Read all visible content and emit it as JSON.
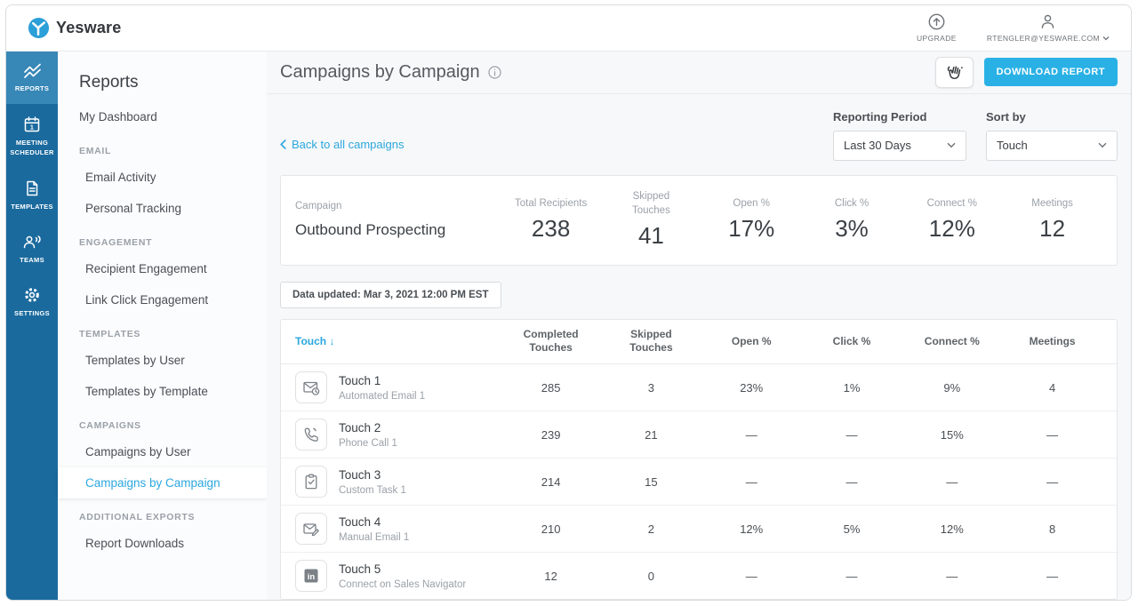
{
  "header": {
    "brand": "Yesware",
    "upgrade_label": "UPGRADE",
    "account_email": "RTENGLER@YESWARE.COM"
  },
  "nav_rail": {
    "items": [
      {
        "label": "REPORTS",
        "icon": "chart-icon",
        "active": true
      },
      {
        "label": "MEETING SCHEDULER",
        "icon": "calendar-icon",
        "active": false
      },
      {
        "label": "TEMPLATES",
        "icon": "document-icon",
        "active": false
      },
      {
        "label": "TEAMS",
        "icon": "people-icon",
        "active": false
      },
      {
        "label": "SETTINGS",
        "icon": "gear-icon",
        "active": false
      }
    ]
  },
  "sidebar": {
    "title": "Reports",
    "items": [
      {
        "label": "My Dashboard",
        "type": "link"
      },
      {
        "label": "EMAIL",
        "type": "section"
      },
      {
        "label": "Email Activity",
        "type": "link"
      },
      {
        "label": "Personal Tracking",
        "type": "link"
      },
      {
        "label": "ENGAGEMENT",
        "type": "section"
      },
      {
        "label": "Recipient Engagement",
        "type": "link"
      },
      {
        "label": "Link Click Engagement",
        "type": "link"
      },
      {
        "label": "TEMPLATES",
        "type": "section"
      },
      {
        "label": "Templates by User",
        "type": "link"
      },
      {
        "label": "Templates by Template",
        "type": "link"
      },
      {
        "label": "CAMPAIGNS",
        "type": "section"
      },
      {
        "label": "Campaigns by User",
        "type": "link"
      },
      {
        "label": "Campaigns by Campaign",
        "type": "link",
        "active": true
      },
      {
        "label": "ADDITIONAL EXPORTS",
        "type": "section"
      },
      {
        "label": "Report Downloads",
        "type": "link"
      }
    ]
  },
  "main": {
    "title": "Campaigns by Campaign",
    "download_button_label": "DOWNLOAD REPORT",
    "back_link": "Back to all campaigns",
    "filters": {
      "reporting_period_label": "Reporting Period",
      "reporting_period_value": "Last 30 Days",
      "sort_by_label": "Sort by",
      "sort_by_value": "Touch"
    },
    "summary": {
      "columns": [
        "Campaign",
        "Total Recipients",
        "Skipped Touches",
        "Open %",
        "Click %",
        "Connect %",
        "Meetings"
      ],
      "campaign_name": "Outbound Prospecting",
      "values": [
        "238",
        "41",
        "17%",
        "3%",
        "12%",
        "12"
      ]
    },
    "data_updated": "Data updated: Mar 3, 2021 12:00 PM EST",
    "table": {
      "columns": [
        "Touch",
        "Completed Touches",
        "Skipped Touches",
        "Open %",
        "Click %",
        "Connect %",
        "Meetings"
      ],
      "sort_arrow": "↓",
      "rows": [
        {
          "title": "Touch 1",
          "subtitle": "Automated Email 1",
          "icon": "automated-email-icon",
          "values": [
            "285",
            "3",
            "23%",
            "1%",
            "9%",
            "4"
          ]
        },
        {
          "title": "Touch 2",
          "subtitle": "Phone Call 1",
          "icon": "phone-call-icon",
          "values": [
            "239",
            "21",
            "—",
            "—",
            "15%",
            "—"
          ]
        },
        {
          "title": "Touch 3",
          "subtitle": "Custom Task 1",
          "icon": "custom-task-icon",
          "values": [
            "214",
            "15",
            "—",
            "—",
            "—",
            "—"
          ]
        },
        {
          "title": "Touch 4",
          "subtitle": "Manual Email 1",
          "icon": "manual-email-icon",
          "values": [
            "210",
            "2",
            "12%",
            "5%",
            "12%",
            "8"
          ]
        },
        {
          "title": "Touch 5",
          "subtitle": "Connect on Sales Navigator",
          "icon": "linkedin-icon",
          "values": [
            "12",
            "0",
            "—",
            "—",
            "—",
            "—"
          ]
        }
      ]
    }
  },
  "colors": {
    "accent_blue": "#2ba7df",
    "rail_blue": "#1a6a9e",
    "rail_active_blue": "#3787b7",
    "download_button_blue": "#29b1e6",
    "logo_blue": "#2b9fd8"
  }
}
